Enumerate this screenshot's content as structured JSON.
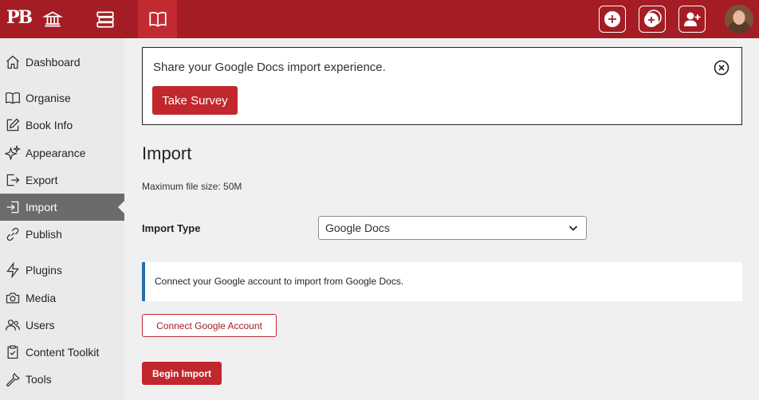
{
  "topbar": {
    "logo": "PB",
    "icons": [
      "institution-icon",
      "books-stack-icon",
      "open-book-icon"
    ],
    "actions": [
      "add-book-icon",
      "add-clone-icon",
      "add-user-icon"
    ]
  },
  "sidebar": {
    "items": [
      {
        "label": "Dashboard",
        "icon": "home-icon"
      },
      {
        "label": "Organise",
        "icon": "open-book-icon"
      },
      {
        "label": "Book Info",
        "icon": "pencil-square-icon"
      },
      {
        "label": "Appearance",
        "icon": "sparkles-icon"
      },
      {
        "label": "Export",
        "icon": "export-icon"
      },
      {
        "label": "Import",
        "icon": "import-icon",
        "active": true
      },
      {
        "label": "Publish",
        "icon": "link-icon"
      },
      {
        "label": "Plugins",
        "icon": "lightning-icon"
      },
      {
        "label": "Media",
        "icon": "camera-icon"
      },
      {
        "label": "Users",
        "icon": "users-icon"
      },
      {
        "label": "Content Toolkit",
        "icon": "clipboard-check-icon"
      },
      {
        "label": "Tools",
        "icon": "wrench-icon"
      }
    ]
  },
  "survey": {
    "text": "Share your Google Docs import experience.",
    "button": "Take Survey"
  },
  "main": {
    "title": "Import",
    "max_file_size": "Maximum file size: 50M",
    "import_type_label": "Import Type",
    "import_type_value": "Google Docs",
    "notice": "Connect your Google account to import from Google Docs.",
    "connect_button": "Connect Google Account",
    "begin_button": "Begin Import"
  },
  "colors": {
    "brand": "#a51d24",
    "button": "#c1272d",
    "notice_border": "#2271b1"
  }
}
